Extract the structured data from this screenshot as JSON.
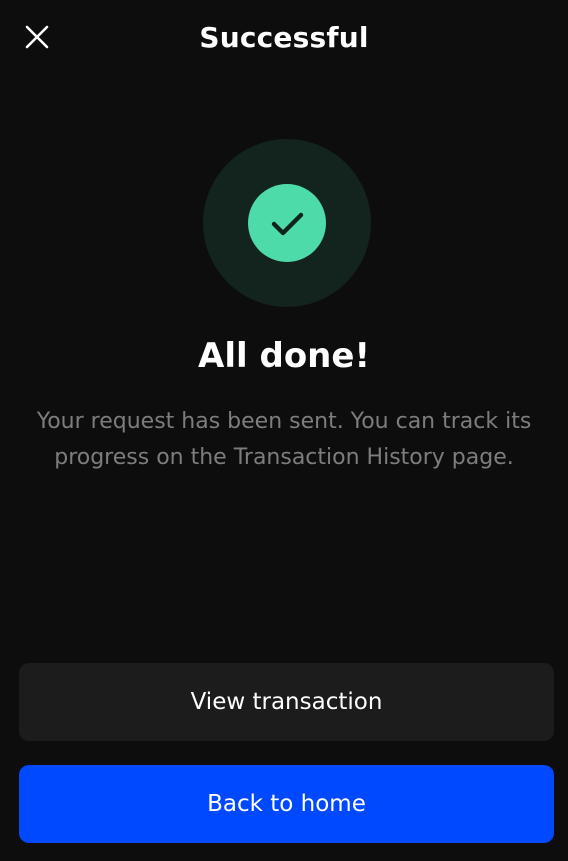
{
  "header": {
    "title": "Successful",
    "close_icon": "close-icon"
  },
  "status": {
    "icon": "checkmark-icon",
    "headline": "All done!",
    "message": "Your request has been sent. You can track its progress on the Transaction History page."
  },
  "actions": {
    "view_transaction_label": "View transaction",
    "back_home_label": "Back to home"
  },
  "colors": {
    "background": "#0d0d0d",
    "success_ring": "#13241f",
    "success": "#4ddba9",
    "check": "#10241c",
    "secondary_button": "#1c1c1c",
    "primary_button": "#0049ff",
    "muted_text": "#7d7d7d"
  }
}
